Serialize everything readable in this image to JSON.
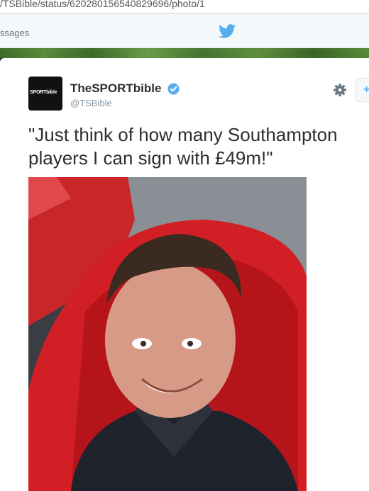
{
  "browser": {
    "url": "/TSBible/status/620280156540829696/photo/1"
  },
  "nav": {
    "messages_label": "ssages",
    "logo_icon": "twitter-bird-icon"
  },
  "tweet": {
    "display_name": "TheSPORTbible",
    "handle": "@TSBible",
    "verified": true,
    "avatar_text": "SPORTbible",
    "text_line1": "\"Just think of how many Southampton",
    "text_line2": "players I can sign with £49m!\"",
    "follow_label": "+",
    "settings_icon": "gear-icon"
  },
  "colors": {
    "twitter_blue": "#55acee",
    "text": "#292f33",
    "muted": "#8899a6"
  }
}
